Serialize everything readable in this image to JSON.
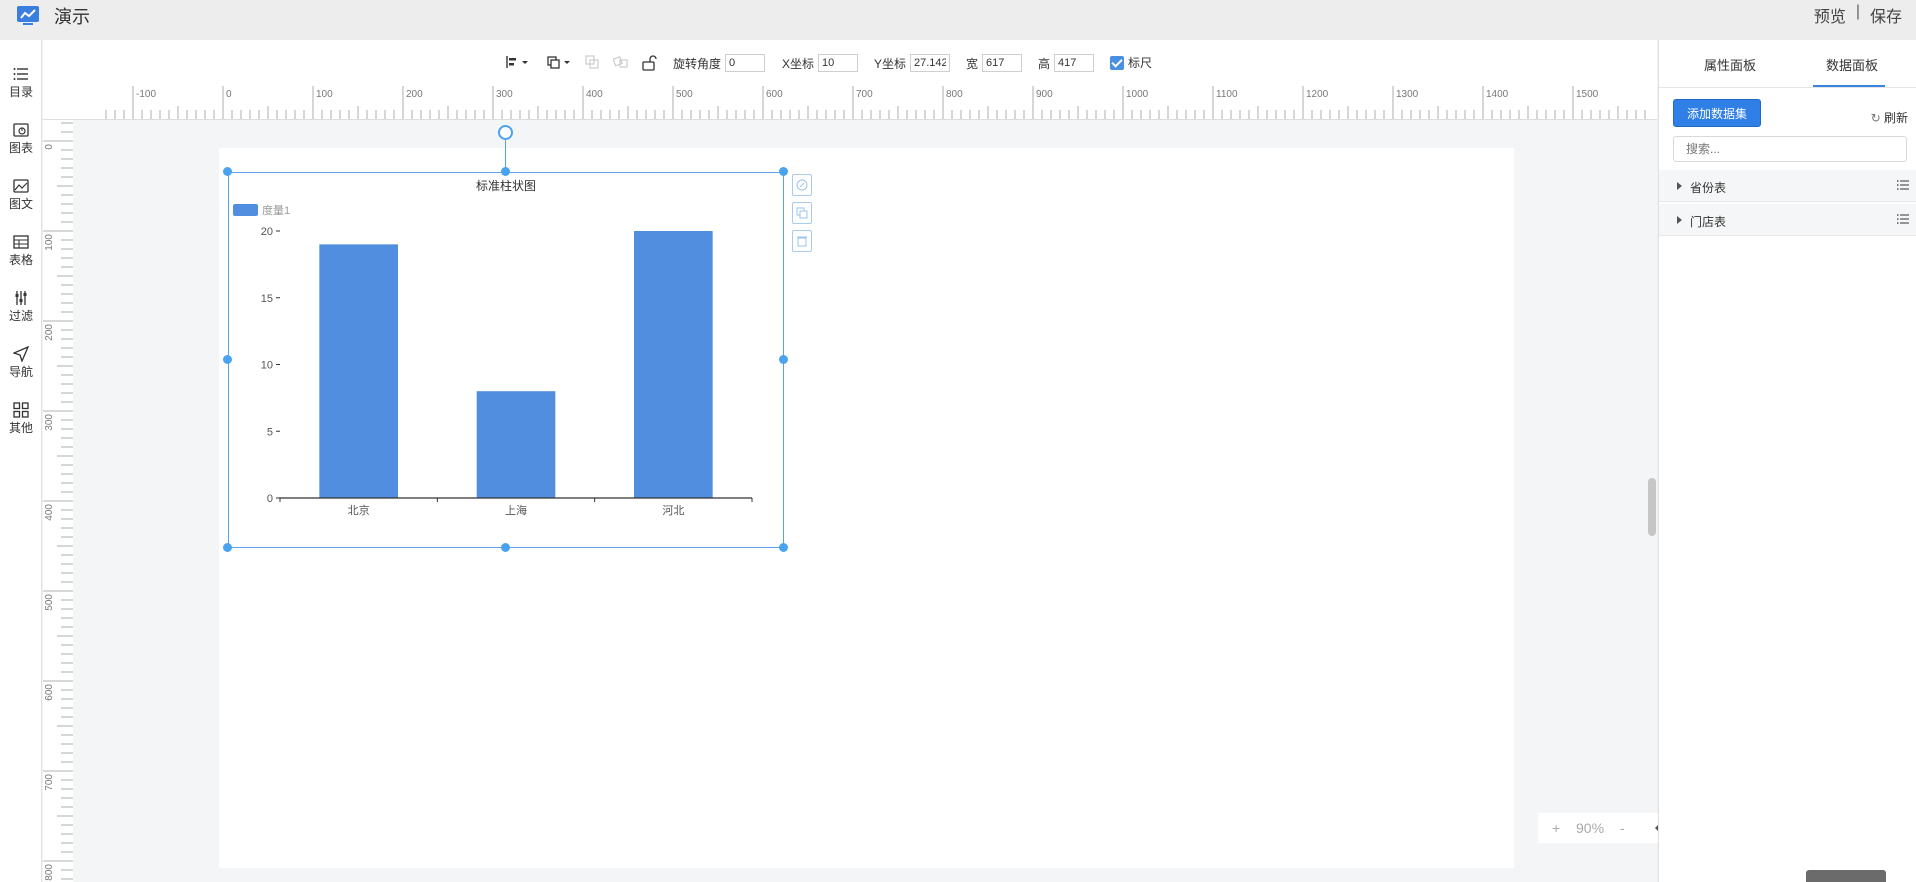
{
  "header": {
    "title": "演示",
    "preview_label": "预览",
    "separator": "|",
    "save_label": "保存"
  },
  "sidebar": {
    "items": [
      {
        "label": "目录",
        "icon": "list-icon"
      },
      {
        "label": "图表",
        "icon": "chart-icon"
      },
      {
        "label": "图文",
        "icon": "image-text-icon"
      },
      {
        "label": "表格",
        "icon": "table-icon"
      },
      {
        "label": "过滤",
        "icon": "filter-icon"
      },
      {
        "label": "导航",
        "icon": "navigation-icon"
      },
      {
        "label": "其他",
        "icon": "grid-icon"
      }
    ]
  },
  "toolbar": {
    "rotation_label": "旋转角度",
    "rotation_value": "0",
    "x_label": "X坐标",
    "x_value": "10",
    "y_label": "Y坐标",
    "y_value": "27.142",
    "width_label": "宽",
    "width_value": "617",
    "height_label": "高",
    "height_value": "417",
    "ruler_label": "标尺",
    "ruler_checked": true
  },
  "rulers": {
    "top_ticks": [
      "-100",
      "0",
      "100",
      "200",
      "300",
      "400",
      "500",
      "600",
      "700",
      "800",
      "900",
      "1000",
      "1100",
      "1200",
      "1300",
      "1400",
      "1500"
    ],
    "left_ticks": [
      "0",
      "100",
      "200",
      "300",
      "400",
      "500",
      "600",
      "700",
      "800"
    ]
  },
  "chart_data": {
    "type": "bar",
    "title": "标准柱状图",
    "categories": [
      "北京",
      "上海",
      "河北"
    ],
    "series": [
      {
        "name": "度量1",
        "values": [
          19,
          8,
          20
        ],
        "color": "#528ee0"
      }
    ],
    "ylim": [
      0,
      20
    ],
    "yticks": [
      "0",
      "5",
      "10",
      "15",
      "20"
    ],
    "legend": "top-left",
    "grid": false
  },
  "zoom": {
    "plus": "+",
    "value": "90%",
    "minus": "-"
  },
  "right_panel": {
    "tabs": [
      "属性面板",
      "数据面板"
    ],
    "active_tab": "数据面板",
    "add_dataset_label": "添加数据集",
    "refresh_label": "刷新",
    "search_placeholder": "搜索...",
    "datasets": [
      {
        "label": "省份表"
      },
      {
        "label": "门店表"
      }
    ]
  },
  "colors": {
    "accent": "#2f7fe6",
    "bar": "#528ee0",
    "selection": "#4aa3f0"
  }
}
